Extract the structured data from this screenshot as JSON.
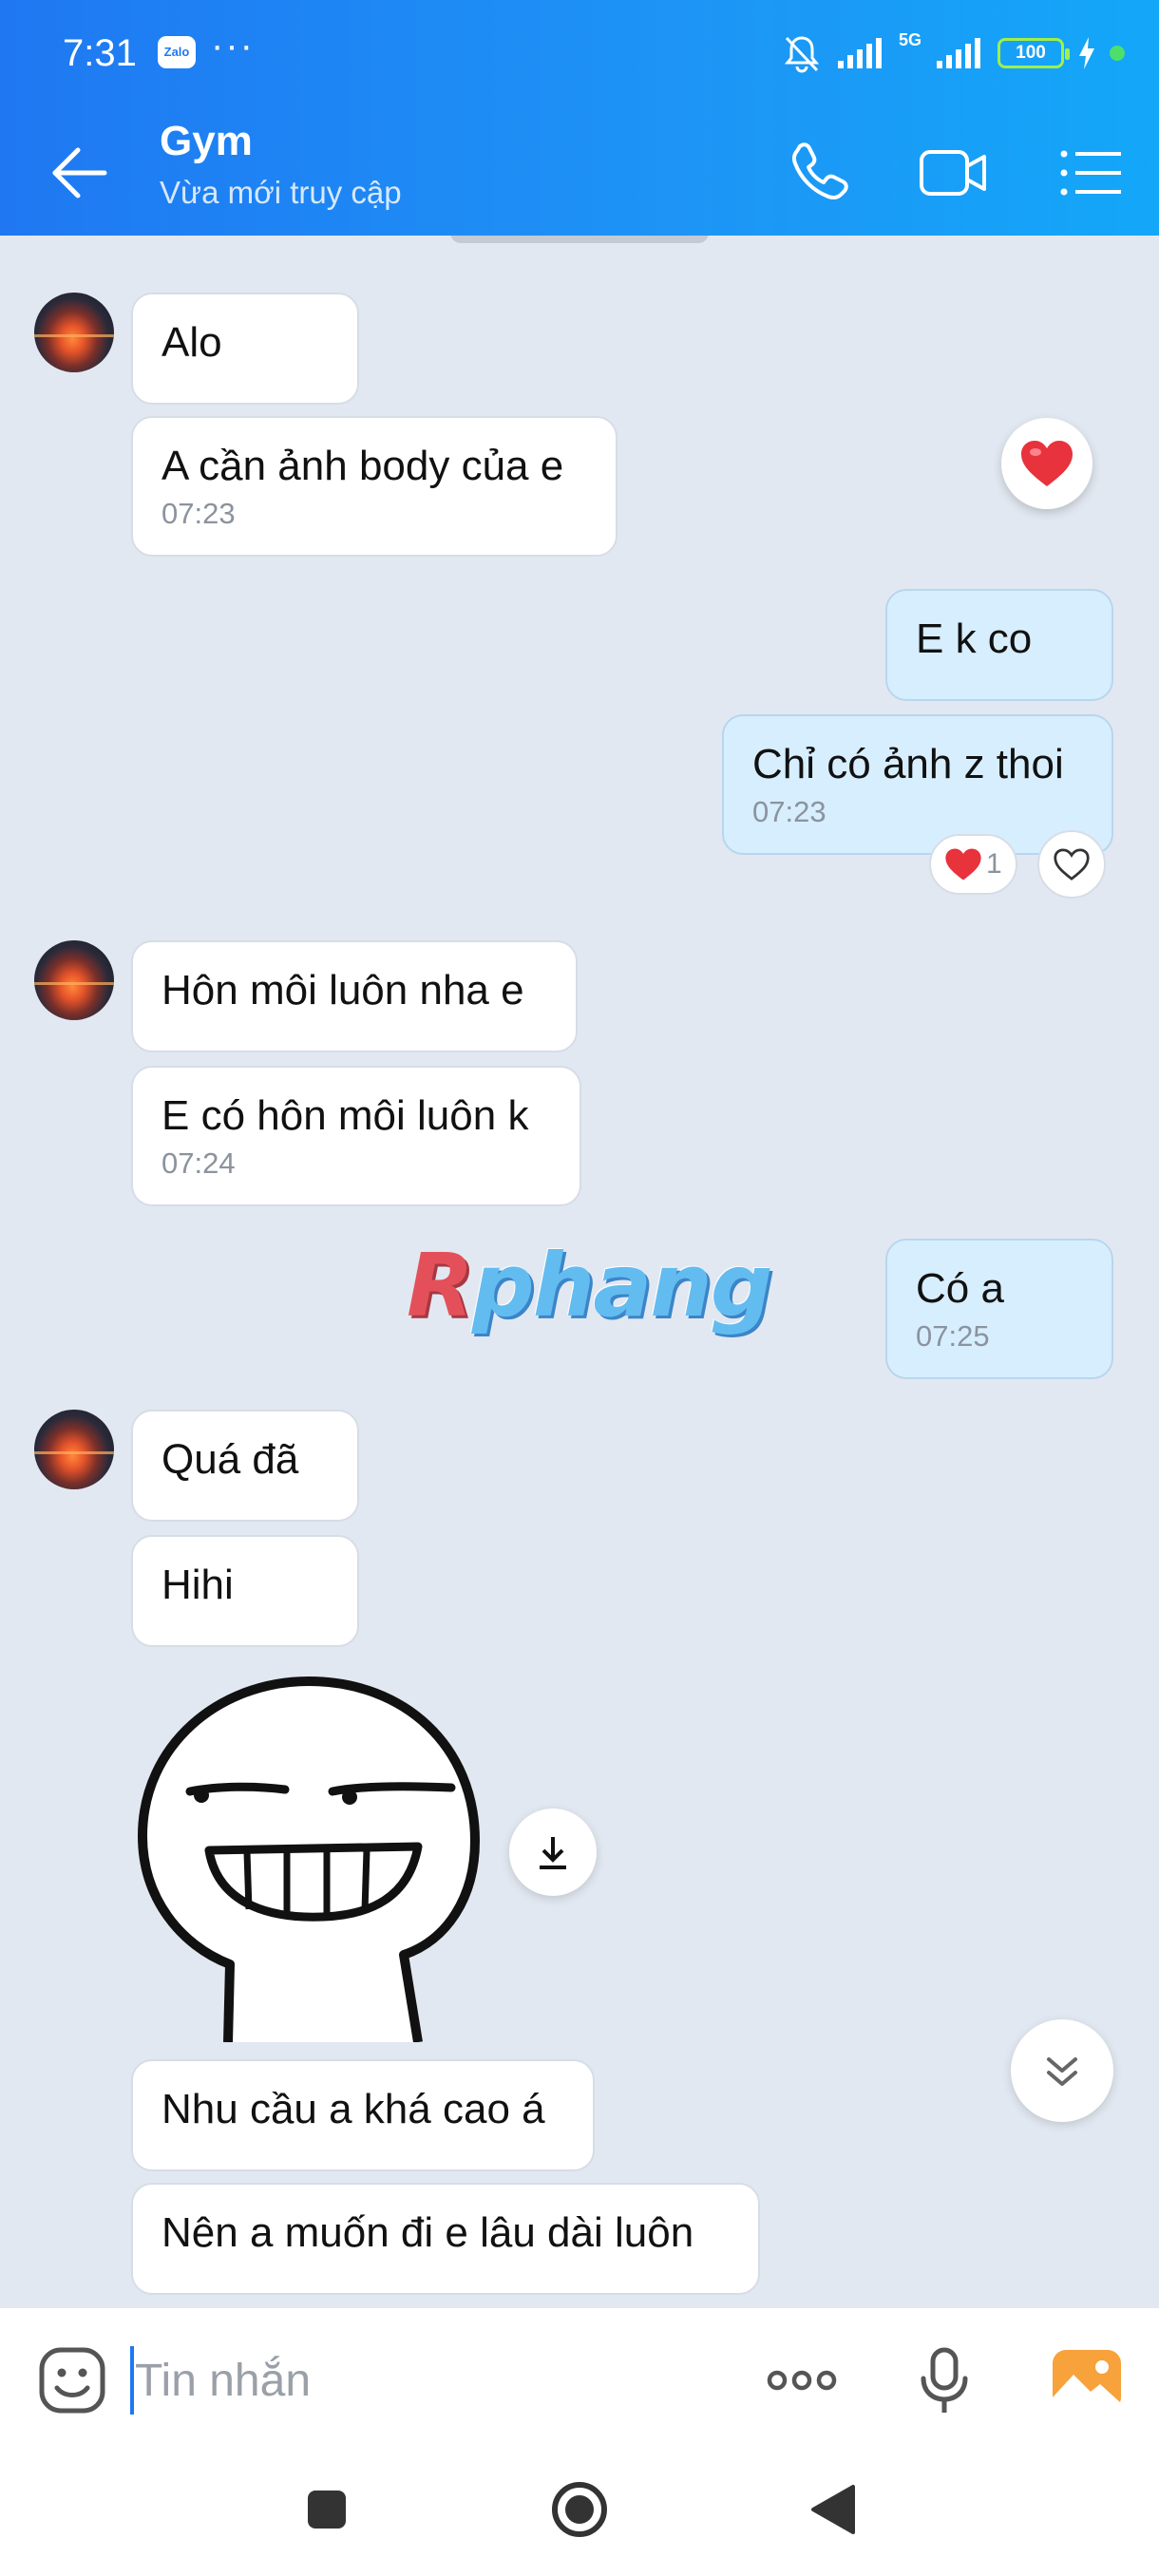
{
  "status_bar": {
    "time": "7:31",
    "app_badge": "Zalo",
    "more": "···",
    "network": "5G",
    "battery": "100"
  },
  "header": {
    "title": "Gym",
    "subtitle": "Vừa mới truy cập"
  },
  "messages": {
    "m1": {
      "text": "Alo"
    },
    "m2": {
      "text": "A cần ảnh body của e",
      "time": "07:23"
    },
    "m3": {
      "text": "E k co"
    },
    "m4": {
      "text": "Chỉ có ảnh z thoi",
      "time": "07:23",
      "reaction_count": "1"
    },
    "m5": {
      "text": "Hôn môi luôn nha e"
    },
    "m6": {
      "text": "E có hôn môi luôn k",
      "time": "07:24"
    },
    "m7": {
      "text": "Có a",
      "time": "07:25"
    },
    "m8": {
      "text": "Quá đã"
    },
    "m9": {
      "text": "Hihi"
    },
    "m10": {
      "text": "Nhu cầu a khá cao á"
    },
    "m11": {
      "text": "Nên a muốn đi e lâu dài luôn"
    }
  },
  "watermark": {
    "first": "R",
    "rest": "phang"
  },
  "input": {
    "placeholder": "Tin nhắn",
    "value": ""
  },
  "colors": {
    "header_start": "#1f78f2",
    "header_end": "#13a7f8",
    "chat_bg": "#e2e8f1",
    "incoming_bubble": "#ffffff",
    "outgoing_bubble": "#d7eefe",
    "reaction_heart": "#e8323c"
  },
  "icons": {
    "header": [
      "back-arrow-icon",
      "phone-icon",
      "video-call-icon",
      "menu-list-icon"
    ],
    "input": [
      "emoji-icon",
      "more-icon",
      "microphone-icon",
      "image-icon"
    ],
    "nav": [
      "recents-square-icon",
      "home-circle-icon",
      "back-triangle-icon"
    ]
  }
}
